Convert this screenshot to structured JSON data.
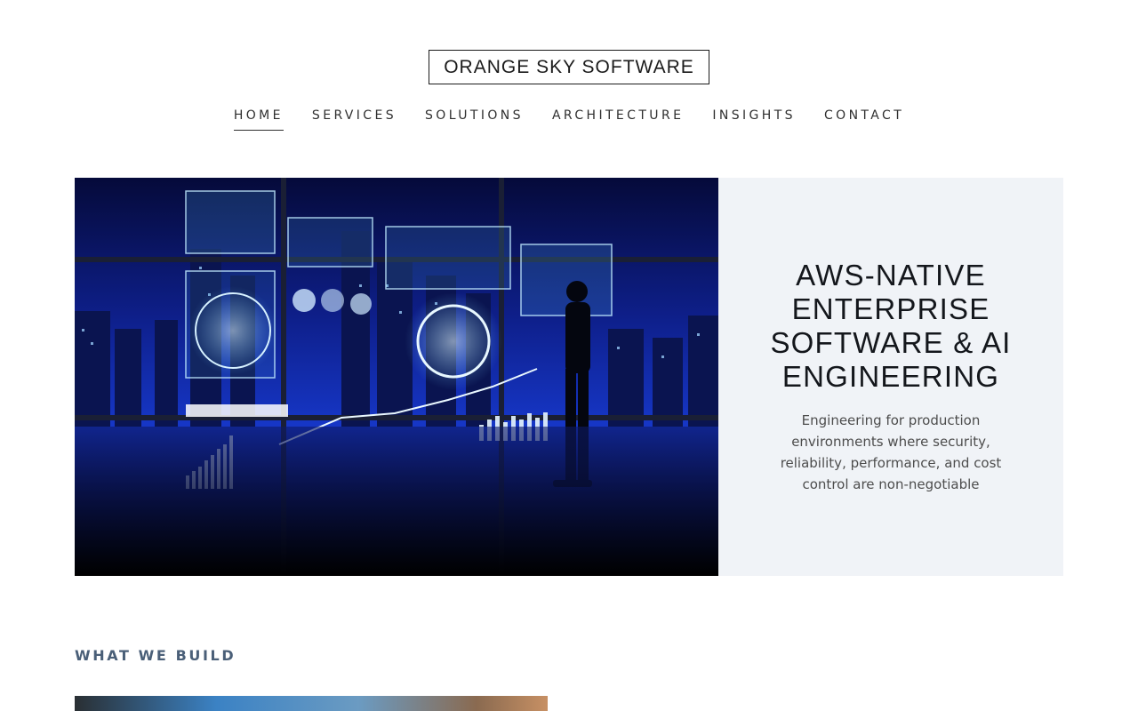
{
  "brand": {
    "name": "ORANGE SKY SOFTWARE"
  },
  "nav": {
    "items": [
      {
        "label": "HOME",
        "active": true
      },
      {
        "label": "SERVICES",
        "active": false
      },
      {
        "label": "SOLUTIONS",
        "active": false
      },
      {
        "label": "ARCHITECTURE",
        "active": false
      },
      {
        "label": "INSIGHTS",
        "active": false
      },
      {
        "label": "CONTACT",
        "active": false
      }
    ]
  },
  "hero": {
    "title": "AWS-NATIVE ENTERPRISE SOFTWARE & AI ENGINEERING",
    "subtitle": "Engineering for production environments where security, reliability, performance, and cost control are non-negotiable"
  },
  "what_we_build": {
    "label": "WHAT WE BUILD"
  },
  "colors": {
    "panel_bg": "#f0f3f7",
    "section_label": "#4a5f78",
    "hero_dark": "#060a2e",
    "hero_blue": "#1d3fd0"
  }
}
